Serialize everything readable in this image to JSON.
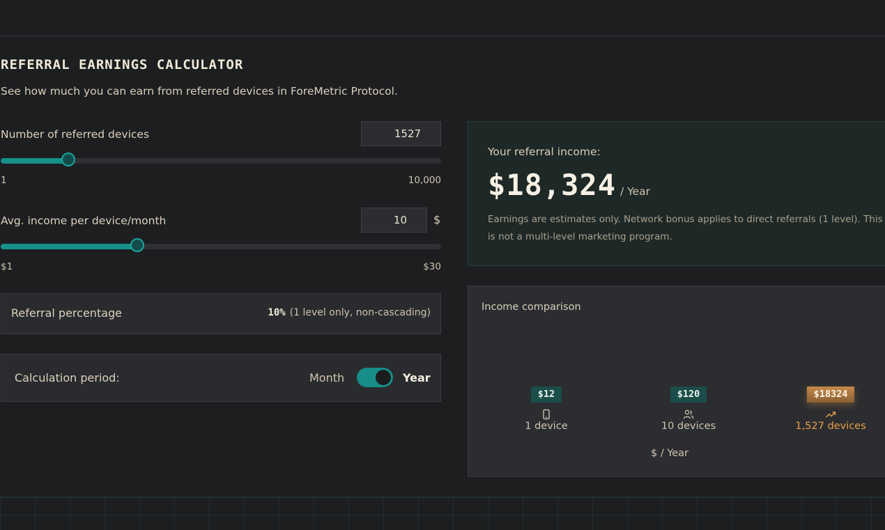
{
  "header": {
    "title": "REFERRAL EARNINGS CALCULATOR",
    "subtitle": "See how much you can earn from referred devices in ForeMetric Protocol."
  },
  "devices": {
    "label": "Number of referred devices",
    "value": "1527",
    "min_label": "1",
    "max_label": "10,000",
    "slider_fraction": 0.1527
  },
  "income": {
    "label": "Avg. income per device/month",
    "value": "10",
    "unit": "$",
    "min_label": "$1",
    "max_label": "$30",
    "slider_fraction": 0.31
  },
  "referral": {
    "label": "Referral percentage",
    "percent": "10%",
    "note": "(1 level only, non-cascading)"
  },
  "period": {
    "label": "Calculation period:",
    "option_month": "Month",
    "option_year": "Year",
    "selected": "Year"
  },
  "result": {
    "label": "Your referral income:",
    "amount": "$18,324",
    "unit": "/ Year",
    "note": "Earnings are estimates only. Network bonus applies to direct referrals (1 level). This is not a multi-level marketing program."
  },
  "comparison": {
    "title": "Income comparison",
    "items": [
      {
        "value": "$12",
        "caption": "1 device",
        "icon": "device-icon"
      },
      {
        "value": "$120",
        "caption": "10 devices",
        "icon": "users-icon"
      },
      {
        "value": "$18324",
        "caption": "1,527 devices",
        "icon": "trending-up-icon"
      }
    ],
    "unit": "$ / Year"
  },
  "colors": {
    "accent_teal": "#16908a",
    "highlight_orange": "#e7a04a"
  }
}
